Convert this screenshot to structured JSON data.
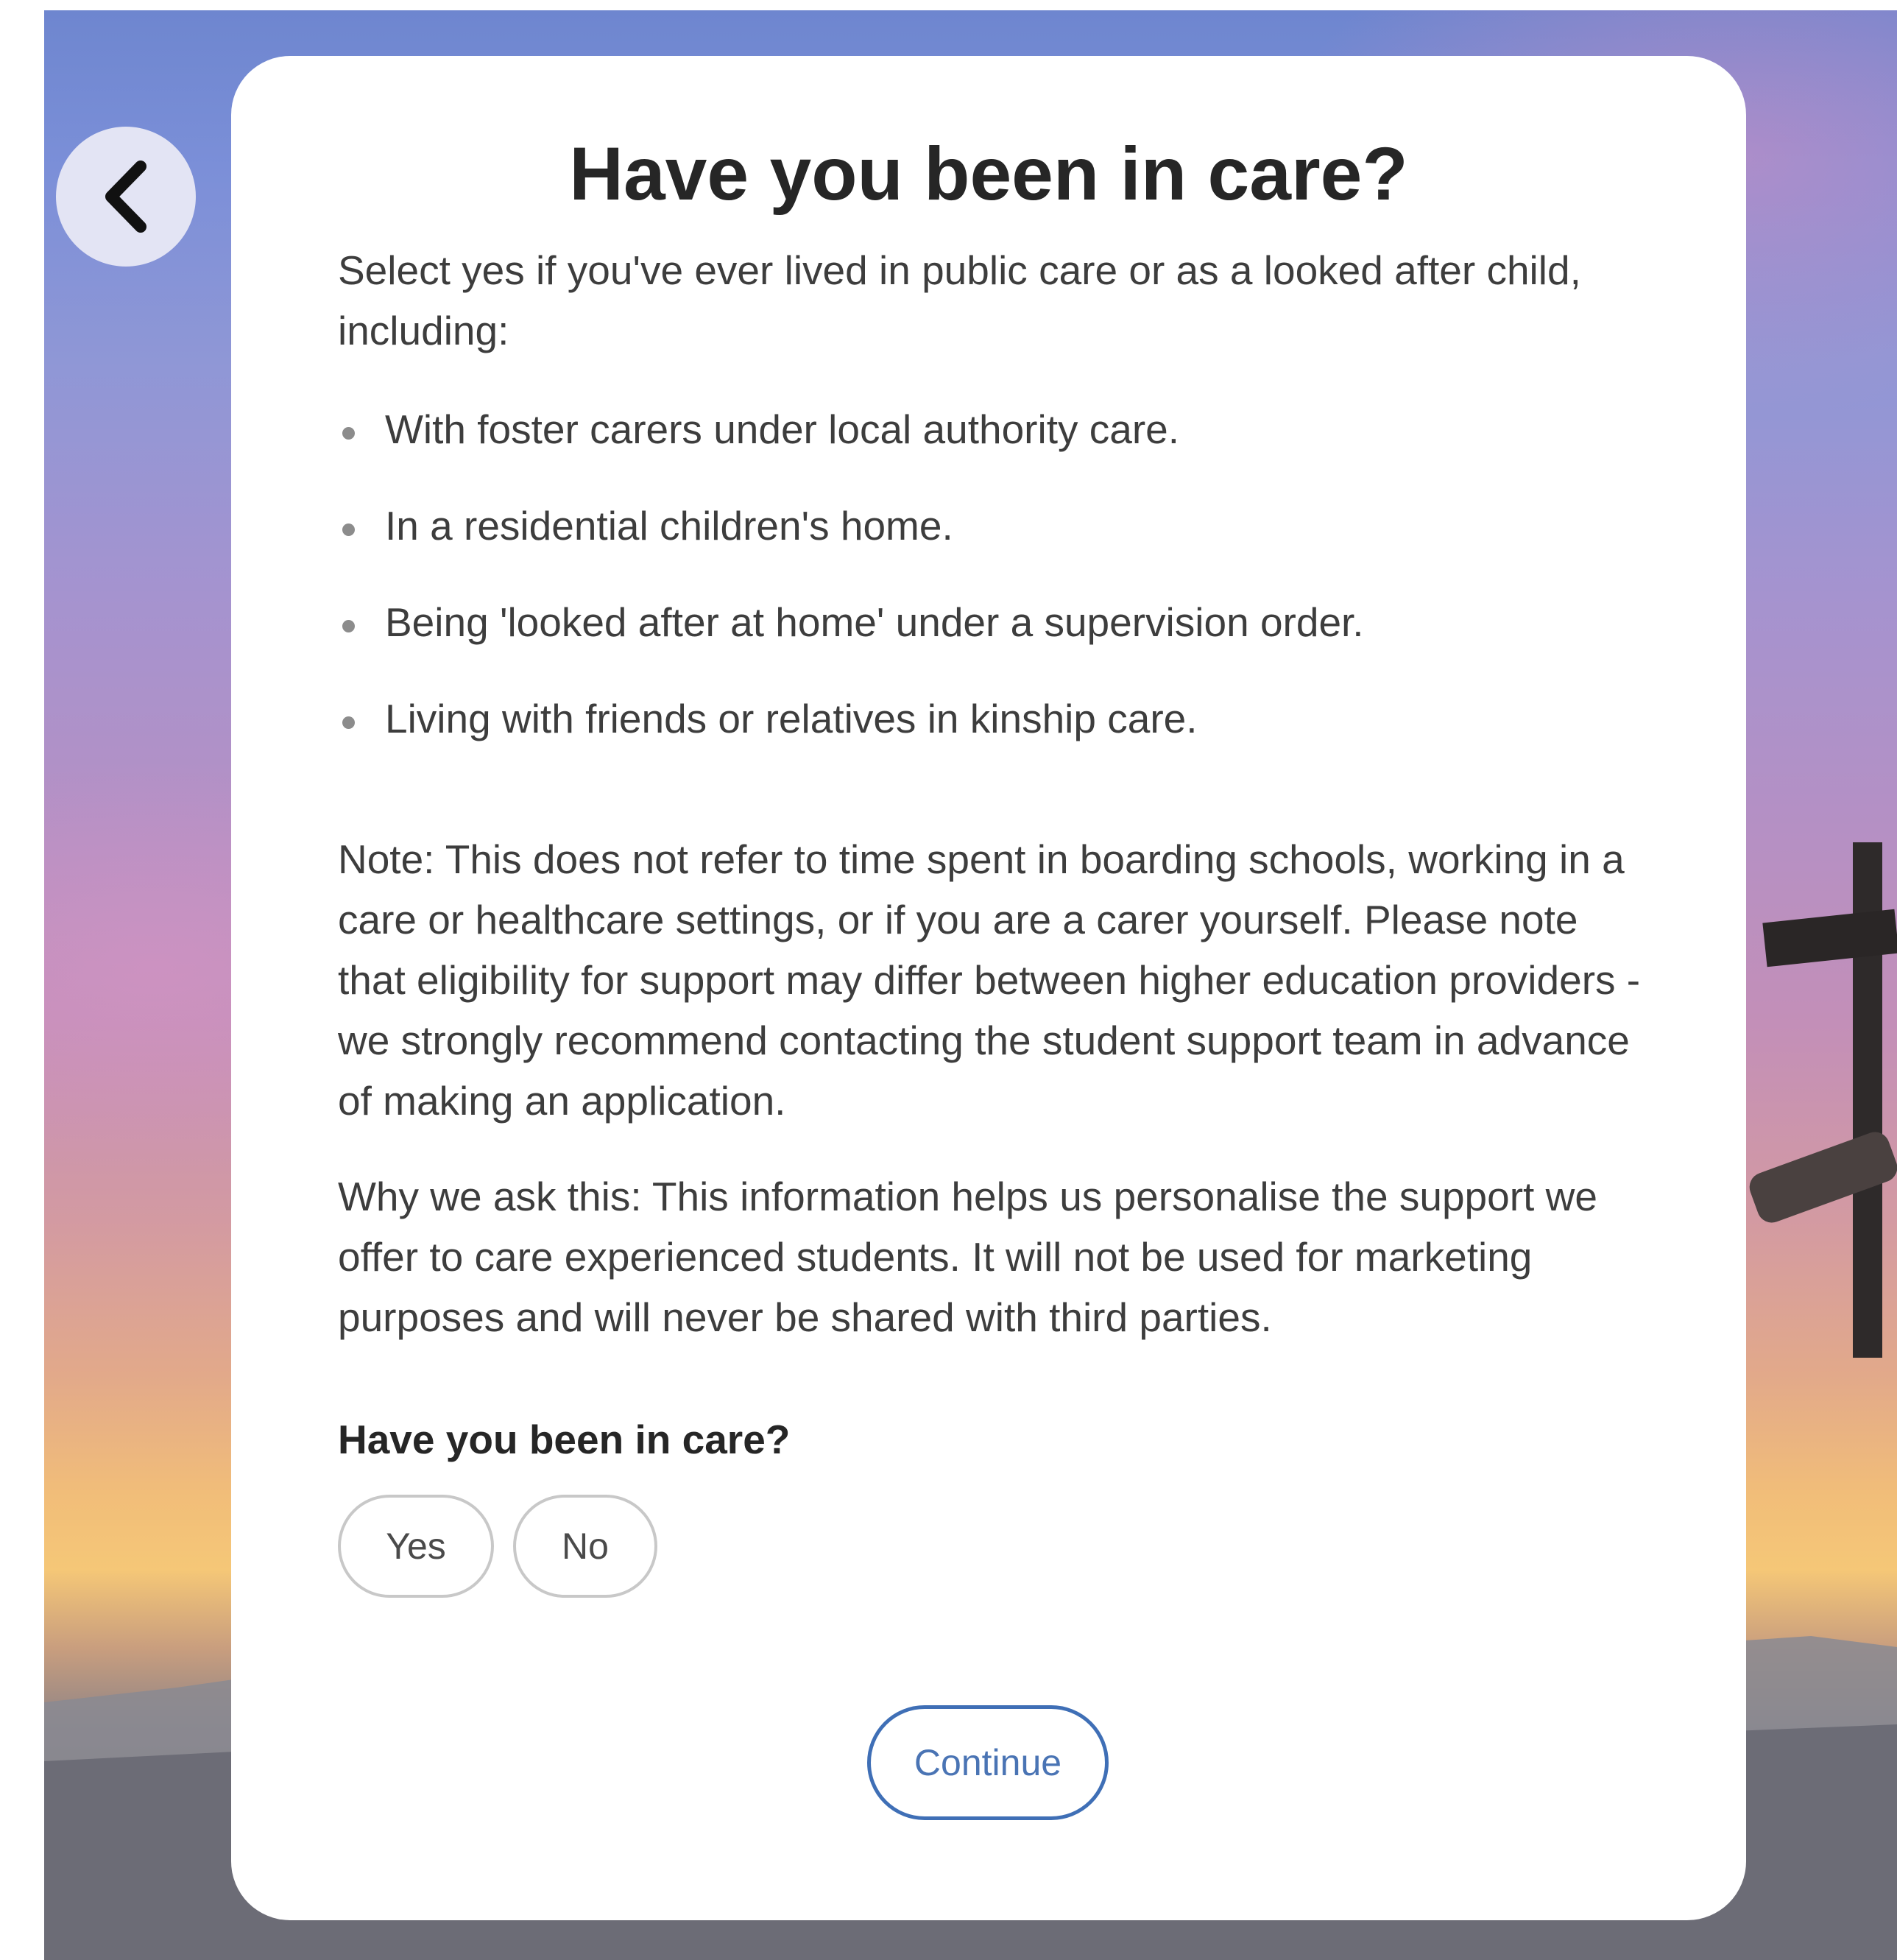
{
  "back_button": {
    "icon": "chevron-left-icon"
  },
  "page": {
    "title": "Have you been in care?",
    "intro": "Select yes if you've ever lived in public care or as a looked after child, including:",
    "bullets": [
      "With foster carers under local authority care.",
      "In a residential children's home.",
      "Being 'looked after at home' under a supervision order.",
      "Living with friends or relatives in kinship care."
    ],
    "note": "Note: This does not refer to time spent in boarding schools, working in a care or healthcare settings, or if you are a carer yourself. Please note that eligibility for support may differ between higher education providers - we strongly recommend contacting the student support team in advance of making an application.",
    "why": "Why we ask this: This information helps us personalise the support we offer to care experienced students. It will not be used for marketing purposes and will never be shared with third parties."
  },
  "question": {
    "label": "Have you been in care?",
    "options": [
      "Yes",
      "No"
    ],
    "selected": null
  },
  "continue_button": {
    "label": "Continue"
  },
  "colors": {
    "accent": "#3f6fb6",
    "back_button_bg": "#e3e4f4",
    "option_border": "#c8c8c8",
    "title_text": "#262626",
    "body_text": "#3d3d3d"
  }
}
